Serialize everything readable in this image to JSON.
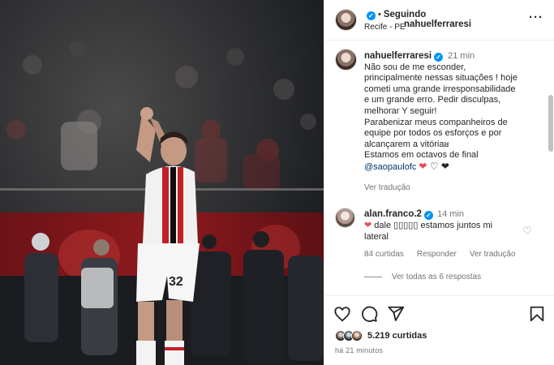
{
  "header": {
    "username": "nahuelferraresi",
    "follow_label": "Seguindo",
    "location": "Recife - PE"
  },
  "caption": {
    "username": "nahuelferraresi",
    "time": "21 min",
    "lines": [
      "Não sou de me esconder,",
      "principalmente nessas situações ! hoje",
      "cometi uma grande irresponsabilidade",
      "e um grande erro. Pedir disculpas,",
      "melhorar Y seguir!",
      "Parabenizar meus companheiros de",
      "equipe por todos os esforços e por",
      "alcançarem a vitóriaᴚ",
      "Estamos em octavos de final"
    ],
    "mention": "@saopaulofc",
    "translate_label": "Ver tradução"
  },
  "comment": {
    "username": "alan.franco.2",
    "time": "14 min",
    "text": "dale ▯▯▯▯▯ estamos juntos mi lateral",
    "likes": "84 curtidas",
    "reply_label": "Responder",
    "translate_label": "Ver tradução",
    "view_replies": "Ver todas as 6 respostas"
  },
  "footer": {
    "likes": "5.219 curtidas",
    "date": "há 21 minutos"
  },
  "icons": {
    "verified": "verified-badge-icon",
    "more": "more-options-icon",
    "like": "heart-icon",
    "comment": "comment-icon",
    "share": "share-icon",
    "save": "bookmark-icon"
  },
  "colors": {
    "accent": "#0095f6",
    "link": "#00376b",
    "muted": "#737373",
    "heart_red": "#ed4956"
  }
}
